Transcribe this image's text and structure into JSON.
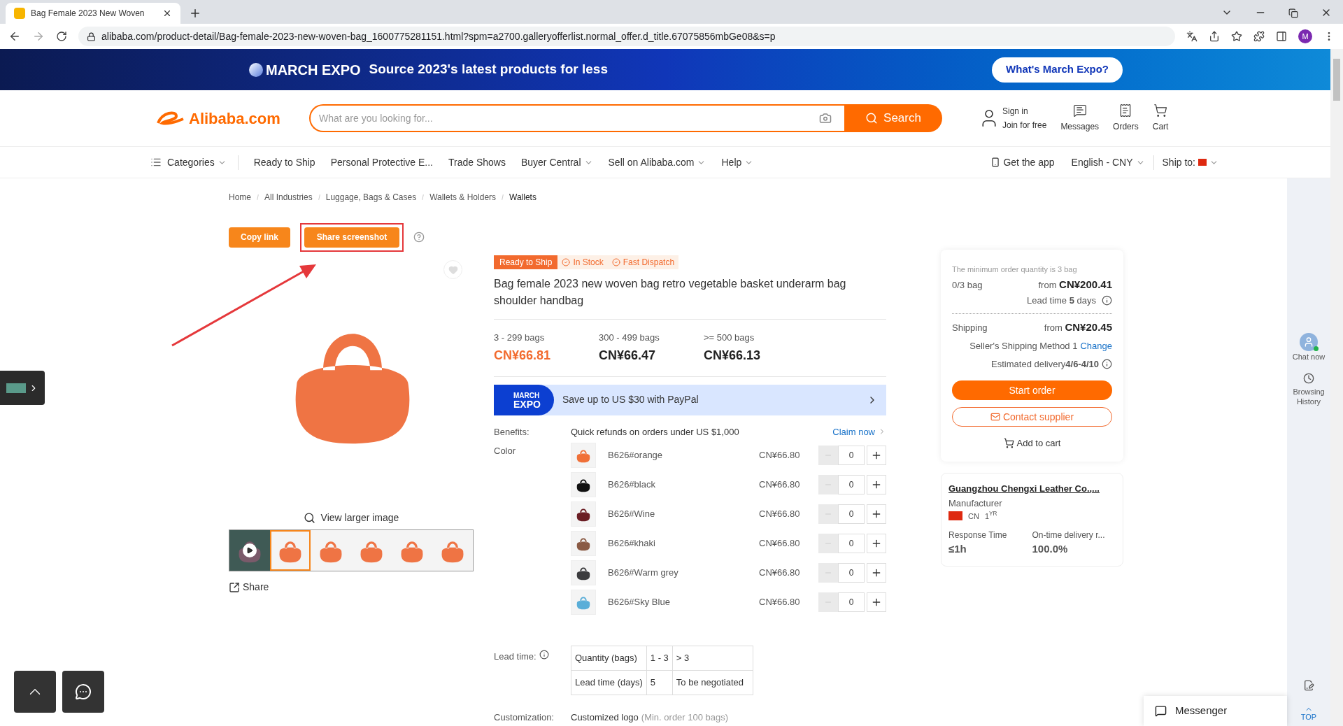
{
  "browser": {
    "tab_title": "Bag Female 2023 New Woven",
    "url": "alibaba.com/product-detail/Bag-female-2023-new-woven-bag_1600775281151.html?spm=a2700.galleryofferlist.normal_offer.d_title.67075856mbGe08&s=p",
    "profile": "M"
  },
  "banner": {
    "brand": "MARCH EXPO",
    "text": "Source 2023's latest products for less",
    "button": "What's March Expo?"
  },
  "header": {
    "logo": "Alibaba.com",
    "search_placeholder": "What are you looking for...",
    "search_button": "Search",
    "sign_in": "Sign in",
    "join": "Join for free",
    "actions": [
      "Messages",
      "Orders",
      "Cart"
    ]
  },
  "nav": {
    "categories": "Categories",
    "items": [
      {
        "label": "Ready to Ship",
        "dropdown": false
      },
      {
        "label": "Personal Protective E...",
        "dropdown": false
      },
      {
        "label": "Trade Shows",
        "dropdown": false
      },
      {
        "label": "Buyer Central",
        "dropdown": true
      },
      {
        "label": "Sell on Alibaba.com",
        "dropdown": true
      },
      {
        "label": "Help",
        "dropdown": true
      }
    ],
    "get_app": "Get the app",
    "language": "English - CNY",
    "ship_to": "Ship to:"
  },
  "breadcrumb": [
    "Home",
    "All Industries",
    "Luggage, Bags & Cases",
    "Wallets & Holders",
    "Wallets"
  ],
  "gallery": {
    "copy_link": "Copy link",
    "share_screenshot": "Share screenshot",
    "view_larger": "View larger image",
    "share": "Share",
    "thumbnails": [
      {
        "kind": "video",
        "selected": false
      },
      {
        "kind": "image",
        "selected": true
      },
      {
        "kind": "image",
        "selected": false
      },
      {
        "kind": "image",
        "selected": false
      },
      {
        "kind": "image",
        "selected": false
      },
      {
        "kind": "image",
        "selected": false
      }
    ]
  },
  "product": {
    "tags": [
      {
        "kind": "solid",
        "label": "Ready to Ship"
      },
      {
        "kind": "check",
        "label": "In Stock"
      },
      {
        "kind": "check",
        "label": "Fast Dispatch"
      }
    ],
    "title": "Bag female 2023 new woven bag retro vegetable basket underarm bag shoulder handbag",
    "tiers": [
      {
        "range": "3 - 299 bags",
        "price": "CN¥66.81",
        "selected": true
      },
      {
        "range": "300 - 499 bags",
        "price": "CN¥66.47",
        "selected": false
      },
      {
        "range": ">= 500 bags",
        "price": "CN¥66.13",
        "selected": false
      }
    ],
    "promo": {
      "badge_top": "MARCH",
      "badge_bottom": "EXPO",
      "text": "Save up to US $30 with PayPal"
    },
    "benefits": {
      "label": "Benefits:",
      "text": "Quick refunds on orders under US $1,000",
      "link": "Claim now"
    },
    "color_label": "Color",
    "variants": [
      {
        "name": "B626#orange",
        "price": "CN¥66.80",
        "quantity": "0",
        "color": "#f07038"
      },
      {
        "name": "B626#black",
        "price": "CN¥66.80",
        "quantity": "0",
        "color": "#111111"
      },
      {
        "name": "B626#Wine",
        "price": "CN¥66.80",
        "quantity": "0",
        "color": "#6b1e24"
      },
      {
        "name": "B626#khaki",
        "price": "CN¥66.80",
        "quantity": "0",
        "color": "#8a5a44"
      },
      {
        "name": "B626#Warm grey",
        "price": "CN¥66.80",
        "quantity": "0",
        "color": "#3c3c3e"
      },
      {
        "name": "B626#Sky Blue",
        "price": "CN¥66.80",
        "quantity": "0",
        "color": "#5aaed8"
      }
    ],
    "lead_time": {
      "label": "Lead time:",
      "rows": [
        [
          "Quantity (bags)",
          "1 - 3",
          "> 3"
        ],
        [
          "Lead time (days)",
          "5",
          "To be negotiated"
        ]
      ]
    },
    "customization": {
      "label": "Customization:",
      "value": "Customized logo",
      "note": "(Min. order 100 bags)"
    }
  },
  "order": {
    "min_note": "The minimum order quantity is 3 bag",
    "count": "0/3 bag",
    "from": "from",
    "price": "CN¥200.41",
    "lead": "Lead time **5** days",
    "shipping": "Shipping",
    "ship_from": "from",
    "ship_price": "CN¥20.45",
    "method": "Seller's Shipping Method 1",
    "change": "Change",
    "delivery": "Estimated delivery**4/6-4/10**",
    "start": "Start order",
    "contact": "Contact supplier",
    "cart": "Add to cart"
  },
  "supplier": {
    "name": "Guangzhou Chengxi Leather Co.,...",
    "type": "Manufacturer",
    "country": "CN",
    "years": "1$^{YR}$",
    "stats": [
      {
        "label": "Response Time",
        "value": "≤1h"
      },
      {
        "label": "On-time delivery r...",
        "value": "100.0%"
      }
    ]
  },
  "sidebar": {
    "chat": "Chat now",
    "history": "Browsing History",
    "top": "TOP"
  },
  "messenger": "Messenger"
}
